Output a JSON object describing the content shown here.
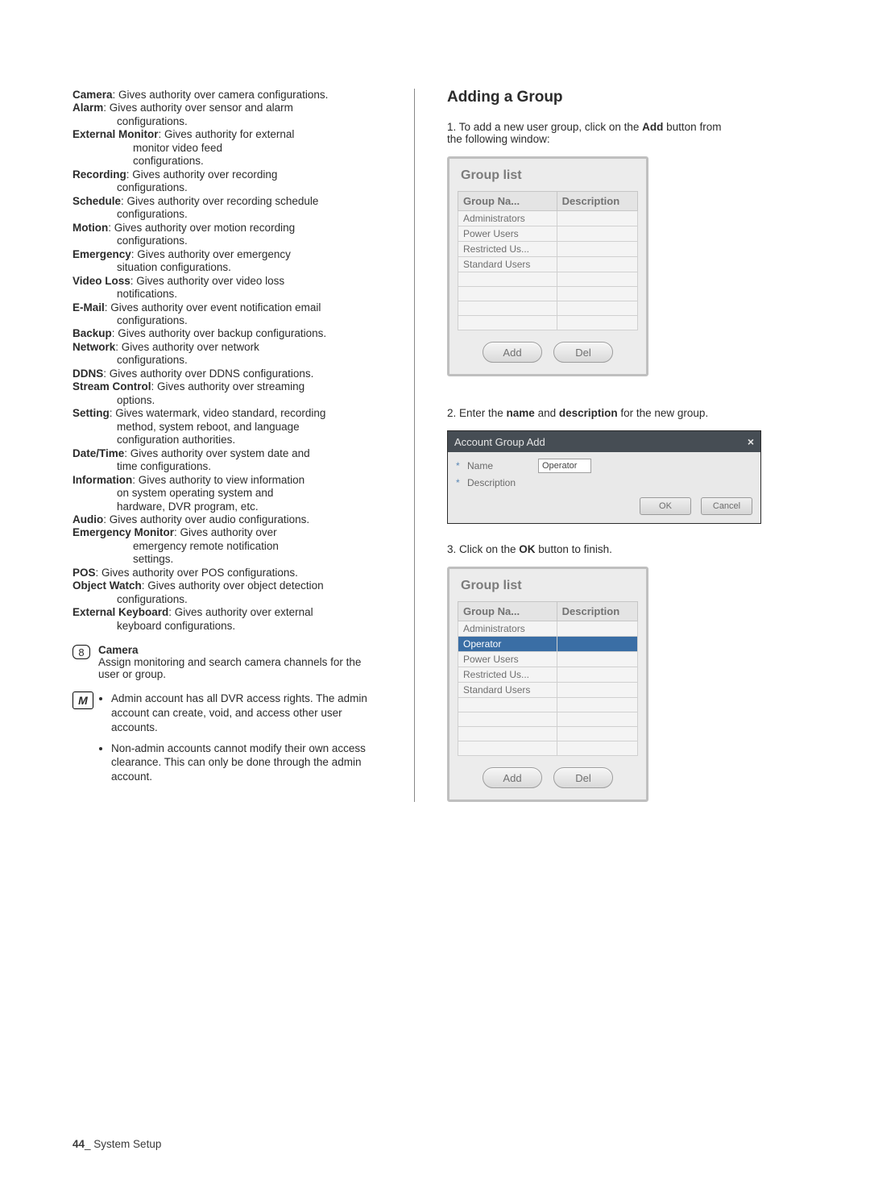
{
  "left_defs": [
    {
      "term": "Camera",
      "text": ": Gives authority over camera configurations."
    },
    {
      "term": "Alarm",
      "text": ": Gives authority over sensor and alarm",
      "cont": [
        "configurations."
      ]
    },
    {
      "term": "External Monitor",
      "text": ": Gives authority for external",
      "cont_ind": [
        "monitor video feed",
        "configurations."
      ]
    },
    {
      "term": "Recording",
      "text": ": Gives authority over recording",
      "cont": [
        "configurations."
      ]
    },
    {
      "term": "Schedule",
      "text": ": Gives authority over recording schedule",
      "cont": [
        "configurations."
      ]
    },
    {
      "term": "Motion",
      "text": ": Gives authority over motion recording",
      "cont": [
        "configurations."
      ]
    },
    {
      "term": "Emergency",
      "text": ": Gives authority over emergency",
      "cont": [
        "situation configurations."
      ]
    },
    {
      "term": "Video Loss",
      "text": ": Gives authority over video loss",
      "cont": [
        "notifications."
      ]
    },
    {
      "term": "E-Mail",
      "text": ": Gives authority over event notification email",
      "cont": [
        "configurations."
      ]
    },
    {
      "term": "Backup",
      "text": ": Gives authority over backup configurations."
    },
    {
      "term": "Network",
      "text": ": Gives authority over network",
      "cont": [
        "configurations."
      ]
    },
    {
      "term": "DDNS",
      "text": ": Gives authority over DDNS configurations."
    },
    {
      "term": "Stream Control",
      "text": ": Gives authority over streaming",
      "cont": [
        "options."
      ]
    },
    {
      "term": "Setting",
      "text": ": Gives watermark, video standard, recording",
      "cont": [
        "method, system reboot, and language",
        "configuration authorities."
      ]
    },
    {
      "term": "Date/Time",
      "text": ": Gives authority over system date and",
      "cont": [
        "time configurations."
      ]
    },
    {
      "term": "Information",
      "text": ": Gives authority to view information",
      "cont": [
        "on system operating system and",
        "hardware, DVR program, etc."
      ]
    },
    {
      "term": "Audio",
      "text": ": Gives authority over audio configurations."
    },
    {
      "term": "Emergency Monitor",
      "text": ": Gives authority over",
      "cont_ind": [
        "emergency remote notification",
        "settings."
      ]
    },
    {
      "term": "POS",
      "text": ": Gives authority over POS configurations."
    },
    {
      "term": "Object Watch",
      "text": ": Gives authority over object detection",
      "cont": [
        "configurations."
      ]
    },
    {
      "term": "External Keyboard",
      "text": ": Gives authority over external",
      "cont": [
        "keyboard configurations."
      ]
    }
  ],
  "step8": {
    "num": "8",
    "title": "Camera",
    "text": "Assign monitoring and search camera channels for the user or group."
  },
  "note_icon": "M",
  "notes": [
    "Admin account has all DVR access rights. The admin account can create, void, and access other user accounts.",
    "Non-admin accounts cannot modify their own access clearance. This can only be done through the admin account."
  ],
  "right": {
    "heading": "Adding a Group",
    "step1_pre": "1. To add a new user group, click on the ",
    "step1_bold": "Add",
    "step1_post": " button from the following window:",
    "grouplist_title": "Group list",
    "table_headers": {
      "col1": "Group Na...",
      "col2": "Description"
    },
    "groups1": [
      "Administrators",
      "Power Users",
      "Restricted Us...",
      "Standard Users"
    ],
    "btn_add": "Add",
    "btn_del": "Del",
    "step2_pre": "2. Enter the ",
    "step2_b1": "name",
    "step2_mid": " and ",
    "step2_b2": "description",
    "step2_post": " for the new group.",
    "dialog": {
      "title": "Account Group Add",
      "close": "×",
      "name_lbl": "Name",
      "desc_lbl": "Description",
      "name_val": "Operator",
      "ok": "OK",
      "cancel": "Cancel"
    },
    "step3_pre": "3. Click on the ",
    "step3_bold": "OK",
    "step3_post": " button to finish.",
    "groups2": [
      "Administrators",
      "Operator",
      "Power Users",
      "Restricted Us...",
      "Standard Users"
    ],
    "selected2": 1
  },
  "footer": {
    "page": "44",
    "sep": "_ ",
    "title": "System Setup"
  }
}
